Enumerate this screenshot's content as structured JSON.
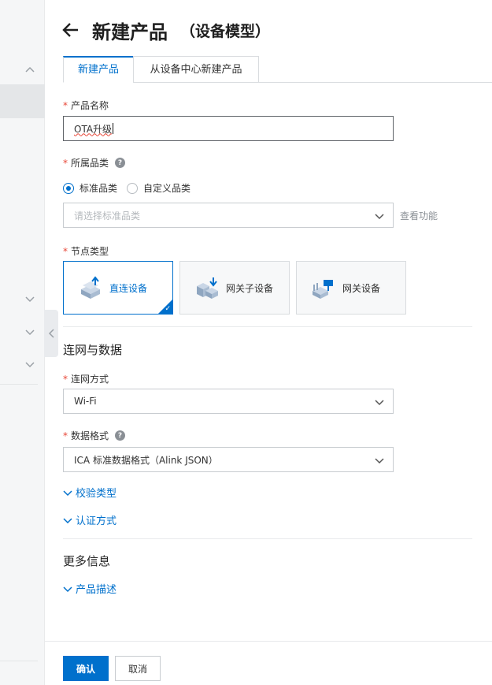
{
  "header": {
    "title": "新建产品",
    "subtitle": "（设备模型）"
  },
  "tabs": [
    {
      "label": "新建产品",
      "active": true
    },
    {
      "label": "从设备中心新建产品",
      "active": false
    }
  ],
  "form": {
    "product_name": {
      "label": "产品名称",
      "value": "OTA升级"
    },
    "category": {
      "label": "所属品类",
      "radios": [
        {
          "label": "标准品类",
          "checked": true
        },
        {
          "label": "自定义品类",
          "checked": false
        }
      ],
      "select_placeholder": "请选择标准品类",
      "view_function": "查看功能"
    },
    "node_type": {
      "label": "节点类型",
      "options": [
        {
          "label": "直连设备",
          "selected": true,
          "icon": "direct-device-icon"
        },
        {
          "label": "网关子设备",
          "selected": false,
          "icon": "gateway-subdevice-icon"
        },
        {
          "label": "网关设备",
          "selected": false,
          "icon": "gateway-device-icon"
        }
      ]
    },
    "network_section": {
      "title": "连网与数据",
      "network_method": {
        "label": "连网方式",
        "value": "Wi-Fi"
      },
      "data_format": {
        "label": "数据格式",
        "value": "ICA 标准数据格式（Alink JSON）"
      },
      "verify_type": "校验类型",
      "auth_method": "认证方式"
    },
    "more_section": {
      "title": "更多信息",
      "product_desc": "产品描述"
    }
  },
  "footer": {
    "confirm": "确认",
    "cancel": "取消"
  },
  "colors": {
    "primary": "#0070cc",
    "required": "#e84738"
  }
}
